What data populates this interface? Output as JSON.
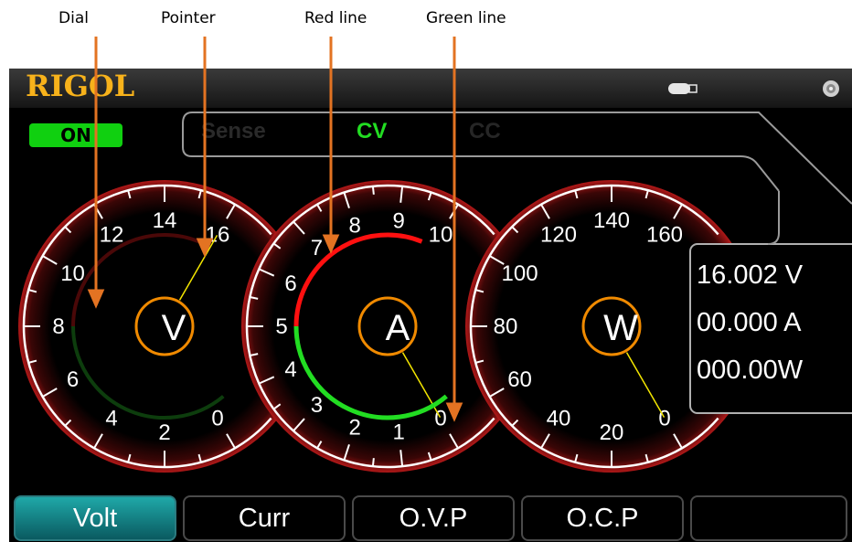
{
  "callouts": {
    "dial": "Dial",
    "pointer": "Pointer",
    "red_line": "Red line",
    "green_line": "Green line"
  },
  "header": {
    "logo": "RIGOL",
    "battery_icon": "battery-icon",
    "speaker_icon": "speaker-icon"
  },
  "status": {
    "output_state": "ON",
    "modes": {
      "sense": "Sense",
      "cv": "CV",
      "cc": "CC"
    }
  },
  "dials": {
    "voltage": {
      "unit": "V",
      "ticks": [
        "0",
        "2",
        "4",
        "6",
        "8",
        "10",
        "12",
        "14",
        "16"
      ],
      "pointer_value": 16.002,
      "max": 16
    },
    "current": {
      "unit": "A",
      "ticks": [
        "0",
        "1",
        "2",
        "3",
        "4",
        "5",
        "6",
        "7",
        "8",
        "9",
        "10"
      ],
      "pointer_value": 0.0,
      "max": 10
    },
    "power": {
      "unit": "W",
      "ticks": [
        "0",
        "20",
        "40",
        "60",
        "80",
        "100",
        "120",
        "140",
        "160"
      ],
      "pointer_value": 0.0,
      "max": 160
    }
  },
  "readouts": {
    "voltage": "16.002 V",
    "current": "00.000 A",
    "power": "000.00W"
  },
  "softkeys": [
    "Volt",
    "Curr",
    "O.V.P",
    "O.C.P",
    ""
  ],
  "colors": {
    "logo": "#f7b21b",
    "on_badge": "#10d010",
    "cv": "#22dd22",
    "unit_ring": "#f08a00",
    "red_line": "#ff1010",
    "green_line": "#22dd22",
    "callout_arrow": "#e37322",
    "softkey_active": "#1fa8a8"
  }
}
